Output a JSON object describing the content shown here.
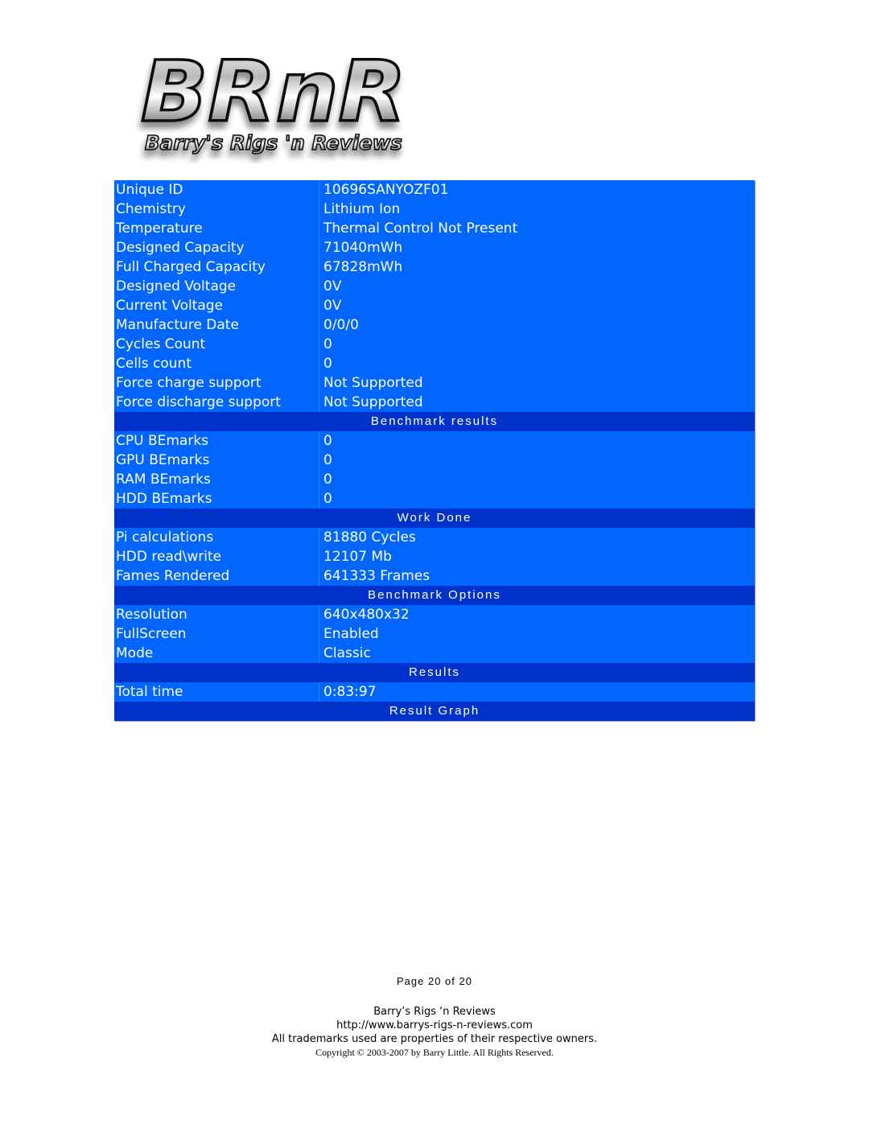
{
  "logo": {
    "title": "BRnR",
    "subtitle": "Barry's Rigs 'n Reviews"
  },
  "colors": {
    "row_bg": "#0066FF",
    "section_bg": "#0033CC",
    "text": "#FFFFFF"
  },
  "battery_info": [
    {
      "label": "Unique ID",
      "value": "10696SANYOZF01"
    },
    {
      "label": "Chemistry",
      "value": "Lithium Ion"
    },
    {
      "label": "Temperature",
      "value": "Thermal Control Not Present"
    },
    {
      "label": "Designed Capacity",
      "value": "71040mWh"
    },
    {
      "label": "Full Charged Capacity",
      "value": "67828mWh"
    },
    {
      "label": "Designed Voltage",
      "value": "0V"
    },
    {
      "label": "Current Voltage",
      "value": "0V"
    },
    {
      "label": "Manufacture Date",
      "value": "0/0/0"
    },
    {
      "label": "Cycles Count",
      "value": "0"
    },
    {
      "label": "Cells count",
      "value": "0"
    },
    {
      "label": "Force charge support",
      "value": "Not Supported"
    },
    {
      "label": "Force discharge support",
      "value": "Not Supported"
    }
  ],
  "sections": {
    "benchmark_results": {
      "title": "Benchmark results",
      "rows": [
        {
          "label": "CPU BEmarks",
          "value": "0"
        },
        {
          "label": "GPU BEmarks",
          "value": "0"
        },
        {
          "label": "RAM BEmarks",
          "value": "0"
        },
        {
          "label": "HDD BEmarks",
          "value": "0"
        }
      ]
    },
    "work_done": {
      "title": "Work Done",
      "rows": [
        {
          "label": "Pi calculations",
          "value": "81880 Cycles"
        },
        {
          "label": "HDD read\\write",
          "value": "12107 Mb"
        },
        {
          "label": "Fames Rendered",
          "value": "641333 Frames"
        }
      ]
    },
    "benchmark_options": {
      "title": "Benchmark Options",
      "rows": [
        {
          "label": "Resolution",
          "value": "640x480x32"
        },
        {
          "label": "FullScreen",
          "value": "Enabled"
        },
        {
          "label": "Mode",
          "value": "Classic"
        }
      ]
    },
    "results": {
      "title": "Results",
      "rows": [
        {
          "label": "Total time",
          "value": "0:83:97"
        }
      ]
    },
    "result_graph": {
      "title": "Result Graph"
    }
  },
  "footer": {
    "page": "Page 20 of 20",
    "site_name": "Barry’s Rigs ‘n Reviews",
    "url": "http://www.barrys-rigs-n-reviews.com",
    "trademarks": "All trademarks used are properties of their respective owners.",
    "copyright": "Copyright © 2003-2007 by Barry Little. All Rights Reserved."
  }
}
